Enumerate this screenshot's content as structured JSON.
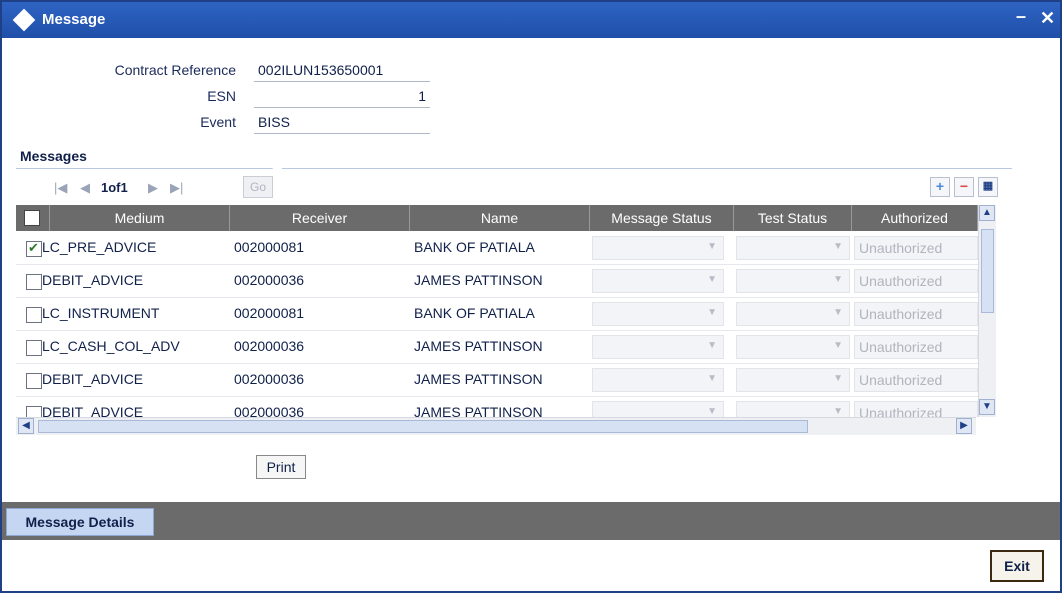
{
  "window": {
    "title": "Message"
  },
  "form": {
    "contract_reference_label": "Contract Reference",
    "contract_reference_value": "002ILUN153650001",
    "esn_label": "ESN",
    "esn_value": "1",
    "event_label": "Event",
    "event_value": "BISS"
  },
  "messages": {
    "section_title": "Messages",
    "pager": {
      "text": "1of1",
      "go_label": "Go"
    },
    "columns": [
      "Medium",
      "Receiver",
      "Name",
      "Message Status",
      "Test Status",
      "Authorized"
    ],
    "rows": [
      {
        "checked": true,
        "medium": "LC_PRE_ADVICE",
        "receiver": "002000081",
        "name": "BANK OF PATIALA",
        "message_status": "",
        "test_status": "",
        "authorized": "Unauthorized"
      },
      {
        "checked": false,
        "medium": "DEBIT_ADVICE",
        "receiver": "002000036",
        "name": "JAMES PATTINSON",
        "message_status": "",
        "test_status": "",
        "authorized": "Unauthorized"
      },
      {
        "checked": false,
        "medium": "LC_INSTRUMENT",
        "receiver": "002000081",
        "name": "BANK OF PATIALA",
        "message_status": "",
        "test_status": "",
        "authorized": "Unauthorized"
      },
      {
        "checked": false,
        "medium": "LC_CASH_COL_ADV",
        "receiver": "002000036",
        "name": "JAMES PATTINSON",
        "message_status": "",
        "test_status": "",
        "authorized": "Unauthorized"
      },
      {
        "checked": false,
        "medium": "DEBIT_ADVICE",
        "receiver": "002000036",
        "name": "JAMES PATTINSON",
        "message_status": "",
        "test_status": "",
        "authorized": "Unauthorized"
      },
      {
        "checked": false,
        "medium": "DEBIT_ADVICE",
        "receiver": "002000036",
        "name": "JAMES PATTINSON",
        "message_status": "",
        "test_status": "",
        "authorized": "Unauthorized"
      }
    ],
    "print_label": "Print"
  },
  "footer": {
    "tab_label": "Message Details",
    "exit_label": "Exit"
  }
}
